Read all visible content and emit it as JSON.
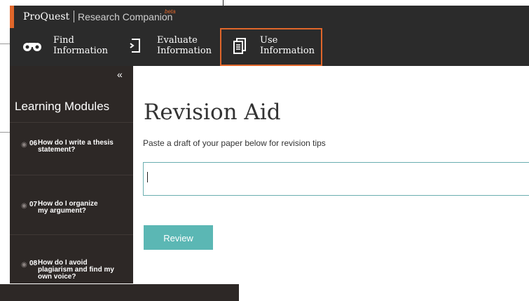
{
  "header": {
    "brand": "ProQuest",
    "product": "Research Companion",
    "badge": "beta"
  },
  "nav": {
    "find": "Find\nInformation",
    "evaluate": "Evaluate\nInformation",
    "use": "Use\nInformation"
  },
  "sidebar": {
    "collapse_label": "«",
    "title": "Learning Modules",
    "modules": [
      {
        "num": "06",
        "label": "How do I write a thesis statement?"
      },
      {
        "num": "07",
        "label": "How do I organize my argument?"
      },
      {
        "num": "08",
        "label": "How do I avoid plagiarism and find my own voice?"
      }
    ]
  },
  "main": {
    "title": "Revision Aid",
    "instructions": "Paste a draft of your paper below for revision tips",
    "input_value": "",
    "review_button": "Review"
  },
  "colors": {
    "accent": "#e0662a",
    "dark": "#2b2b2b",
    "sidebar": "#2d2826",
    "teal": "#5bb7b4"
  }
}
